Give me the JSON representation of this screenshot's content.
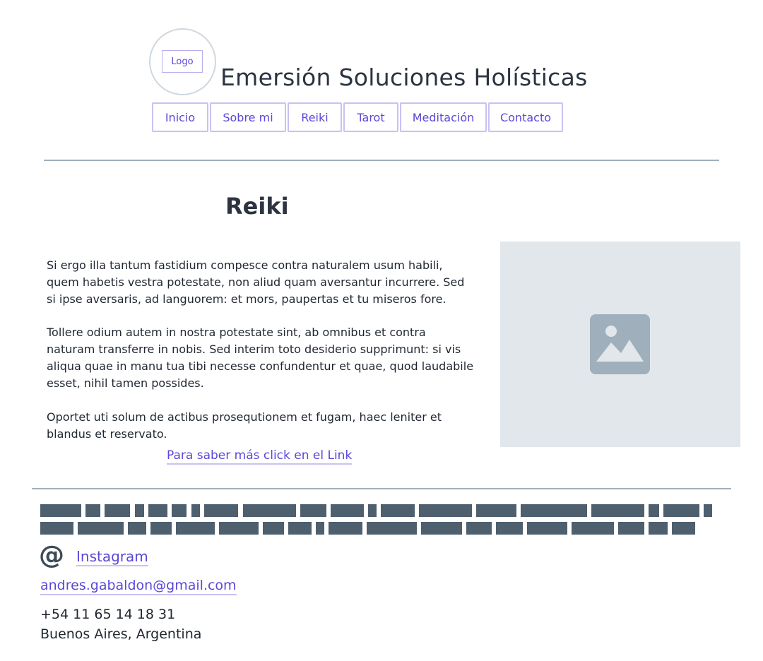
{
  "header": {
    "logo_label": "Logo",
    "site_title": "Emersión Soluciones Holísticas",
    "nav": [
      "Inicio",
      "Sobre mi",
      "Reiki",
      "Tarot",
      "Meditación",
      "Contacto"
    ]
  },
  "main": {
    "heading": "Reiki",
    "paragraphs": [
      [
        "Si ergo illa tantum fastidium compesce contra naturalem usum habili,",
        "quem habetis vestra potestate, non aliud quam aversantur incurrere. Sed",
        "si ipse aversaris, ad languorem: et mors, paupertas et tu miseros fore."
      ],
      [
        "Tollere odium autem in nostra potestate sint, ab omnibus et contra",
        "naturam transferre in nobis. Sed interim toto desiderio supprimunt: si vis",
        "aliqua quae in manu tua tibi necesse confundentur et quae, quod laudabile",
        "esset, nihil tamen possides."
      ],
      [
        "Oportet uti solum de actibus prosequtionem et fugam, haec leniter et",
        "blandus et reservato."
      ]
    ],
    "more_link": "Para saber más click en el Link",
    "image_icon": "image-icon"
  },
  "footer": {
    "instagram_icon": "at-icon",
    "instagram_label": "Instagram",
    "email": "andres.gabaldon@gmail.com",
    "phone": "+54 11 65 14 18 31",
    "location": "Buenos Aires, Argentina"
  },
  "colors": {
    "accent": "#5a48d8",
    "accent_border": "#c9c2f2",
    "text": "#2b3440",
    "divider": "#9fb0bc",
    "placeholder_bg": "#e2e7ec",
    "placeholder_icon": "#9fb0bc",
    "redacted": "#4e5f6e"
  }
}
